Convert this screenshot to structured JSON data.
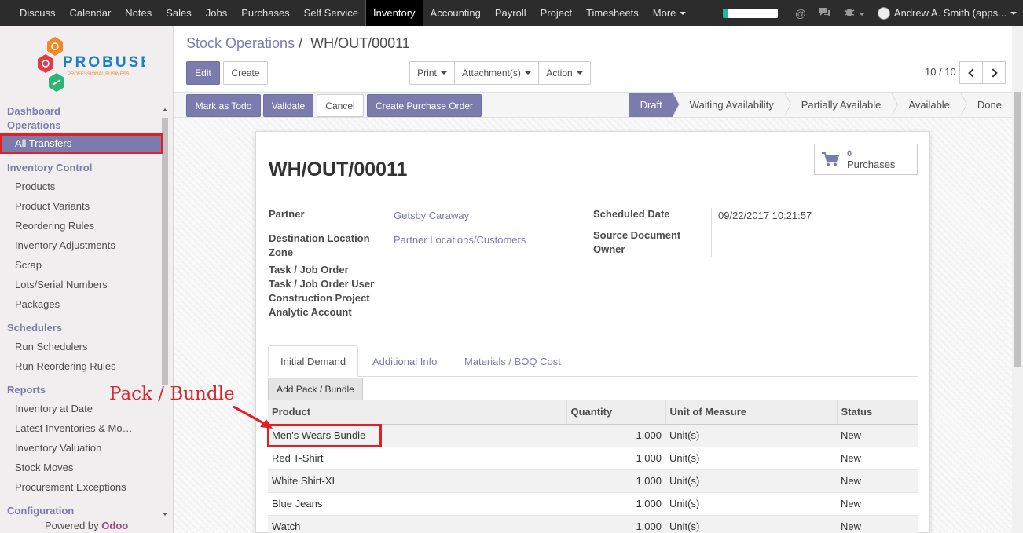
{
  "topbar": {
    "menus": [
      "Discuss",
      "Calendar",
      "Notes",
      "Sales",
      "Jobs",
      "Purchases",
      "Self Service",
      "Inventory",
      "Accounting",
      "Payroll",
      "Project",
      "Timesheets",
      "More"
    ],
    "active_menu": "Inventory",
    "progress": 0.1,
    "user_name": "Andrew A. Smith (apps..."
  },
  "sidebar": {
    "logo_text": "PROBUSE",
    "logo_subtext": "PROFESSIONAL BUSINESS",
    "dashboard": "Dashboard",
    "operations": "Operations",
    "all_transfers": "All Transfers",
    "inventory_control": "Inventory Control",
    "inventory_control_items": [
      "Products",
      "Product Variants",
      "Reordering Rules",
      "Inventory Adjustments",
      "Scrap",
      "Lots/Serial Numbers",
      "Packages"
    ],
    "schedulers": "Schedulers",
    "scheduler_items": [
      "Run Schedulers",
      "Run Reordering Rules"
    ],
    "reports": "Reports",
    "report_items": [
      "Inventory at Date",
      "Latest Inventories & Mo…",
      "Inventory Valuation",
      "Stock Moves",
      "Procurement Exceptions"
    ],
    "configuration": "Configuration",
    "powered_by": "Powered by",
    "powered_brand": "Odoo"
  },
  "breadcrumb": {
    "parent": "Stock Operations",
    "separator": "/",
    "current": "WH/OUT/00011"
  },
  "buttons": {
    "edit": "Edit",
    "create": "Create",
    "print": "Print",
    "attachments": "Attachment(s)",
    "action": "Action",
    "mark_todo": "Mark as Todo",
    "validate": "Validate",
    "cancel": "Cancel",
    "create_po": "Create Purchase Order"
  },
  "pager": {
    "value": "10 / 10"
  },
  "statusbar": {
    "steps": [
      "Draft",
      "Waiting Availability",
      "Partially Available",
      "Available",
      "Done"
    ],
    "active": "Draft"
  },
  "form": {
    "title": "WH/OUT/00011",
    "smart_button": {
      "count": "0",
      "label": "Purchases"
    },
    "labels": {
      "partner": "Partner",
      "dest_location": "Destination Location",
      "zone": "Zone",
      "task": "Task / Job Order",
      "task_user": "Task / Job Order User",
      "construction_project": "Construction Project",
      "analytic_account": "Analytic Account",
      "scheduled_date": "Scheduled Date",
      "source_document": "Source Document",
      "owner": "Owner"
    },
    "values": {
      "partner": "Getsby Caraway",
      "dest_location": "Partner Locations/Customers",
      "scheduled_date": "09/22/2017 10:21:57"
    },
    "tabs": [
      "Initial Demand",
      "Additional Info",
      "Materials / BOQ Cost"
    ],
    "active_tab": "Initial Demand",
    "add_pack_label": "Add Pack / Bundle",
    "table": {
      "columns": [
        "Product",
        "Quantity",
        "Unit of Measure",
        "Status"
      ],
      "rows": [
        [
          "Men's Wears Bundle",
          "1.000",
          "Unit(s)",
          "New"
        ],
        [
          "Red T-Shirt",
          "1.000",
          "Unit(s)",
          "New"
        ],
        [
          "White Shirt-XL",
          "1.000",
          "Unit(s)",
          "New"
        ],
        [
          "Blue Jeans",
          "1.000",
          "Unit(s)",
          "New"
        ],
        [
          "Watch",
          "1.000",
          "Unit(s)",
          "New"
        ]
      ]
    }
  },
  "annotation": {
    "text": "Pack / Bundle",
    "color": "#d9262d"
  },
  "colors": {
    "accent": "#7c7bad",
    "topbar": "#2c2c2c",
    "highlight": "#e31e24"
  }
}
